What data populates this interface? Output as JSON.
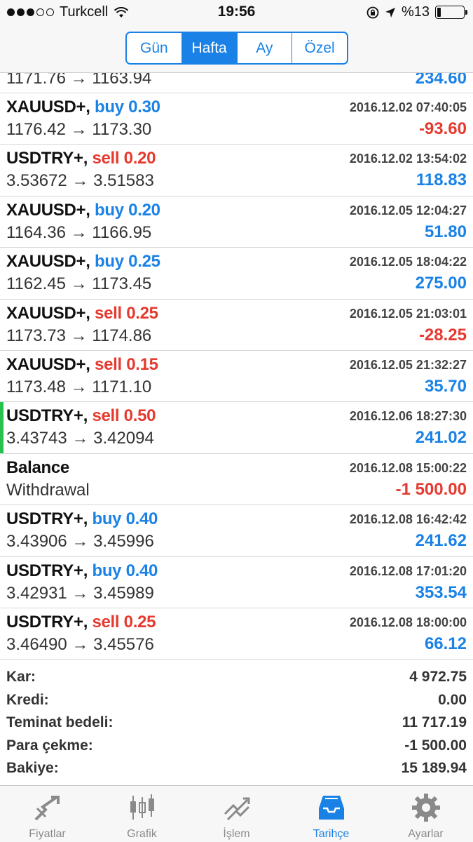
{
  "status_bar": {
    "carrier": "Turkcell",
    "time": "19:56",
    "battery": "%13",
    "battery_level": 0.13
  },
  "period_tabs": [
    {
      "label": "Gün",
      "active": false
    },
    {
      "label": "Hafta",
      "active": true
    },
    {
      "label": "Ay",
      "active": false
    },
    {
      "label": "Özel",
      "active": false
    }
  ],
  "partial_row": {
    "prices": "1171.76 → 1163.94",
    "profit": "234.60"
  },
  "deals": [
    {
      "symbol": "XAUUSD+,",
      "direction": "buy 0.30",
      "side": "buy",
      "date": "2016.12.02 07:40:05",
      "prices": "1176.42 → 1173.30",
      "profit": "-93.60",
      "sign": "neg"
    },
    {
      "symbol": "USDTRY+,",
      "direction": "sell 0.20",
      "side": "sell",
      "date": "2016.12.02 13:54:02",
      "prices": "3.53672 → 3.51583",
      "profit": "118.83",
      "sign": "pos"
    },
    {
      "symbol": "XAUUSD+,",
      "direction": "buy 0.20",
      "side": "buy",
      "date": "2016.12.05 12:04:27",
      "prices": "1164.36 → 1166.95",
      "profit": "51.80",
      "sign": "pos"
    },
    {
      "symbol": "XAUUSD+,",
      "direction": "buy 0.25",
      "side": "buy",
      "date": "2016.12.05 18:04:22",
      "prices": "1162.45 → 1173.45",
      "profit": "275.00",
      "sign": "pos"
    },
    {
      "symbol": "XAUUSD+,",
      "direction": "sell 0.25",
      "side": "sell",
      "date": "2016.12.05 21:03:01",
      "prices": "1173.73 → 1174.86",
      "profit": "-28.25",
      "sign": "neg"
    },
    {
      "symbol": "XAUUSD+,",
      "direction": "sell 0.15",
      "side": "sell",
      "date": "2016.12.05 21:32:27",
      "prices": "1173.48 → 1171.10",
      "profit": "35.70",
      "sign": "pos"
    },
    {
      "symbol": "USDTRY+,",
      "direction": "sell 0.50",
      "side": "sell",
      "date": "2016.12.06 18:27:30",
      "prices": "3.43743 → 3.42094",
      "profit": "241.02",
      "sign": "pos",
      "highlight": true
    },
    {
      "symbol": "Balance",
      "direction": "",
      "side": "none",
      "date": "2016.12.08 15:00:22",
      "prices": "Withdrawal",
      "profit": "-1 500.00",
      "sign": "neg"
    },
    {
      "symbol": "USDTRY+,",
      "direction": "buy 0.40",
      "side": "buy",
      "date": "2016.12.08 16:42:42",
      "prices": "3.43906 → 3.45996",
      "profit": "241.62",
      "sign": "pos"
    },
    {
      "symbol": "USDTRY+,",
      "direction": "buy 0.40",
      "side": "buy",
      "date": "2016.12.08 17:01:20",
      "prices": "3.42931 → 3.45989",
      "profit": "353.54",
      "sign": "pos"
    },
    {
      "symbol": "USDTRY+,",
      "direction": "sell 0.25",
      "side": "sell",
      "date": "2016.12.08 18:00:00",
      "prices": "3.46490 → 3.45576",
      "profit": "66.12",
      "sign": "pos"
    }
  ],
  "summary": [
    {
      "label": "Kar:",
      "value": "4 972.75"
    },
    {
      "label": "Kredi:",
      "value": "0.00"
    },
    {
      "label": "Teminat bedeli:",
      "value": "11 717.19"
    },
    {
      "label": "Para çekme:",
      "value": "-1 500.00"
    },
    {
      "label": "Bakiye:",
      "value": "15 189.94"
    }
  ],
  "tabs": [
    {
      "label": "Fiyatlar",
      "icon": "quotes-icon",
      "active": false
    },
    {
      "label": "Grafik",
      "icon": "chart-icon",
      "active": false
    },
    {
      "label": "İşlem",
      "icon": "trade-icon",
      "active": false
    },
    {
      "label": "Tarihçe",
      "icon": "history-icon",
      "active": true
    },
    {
      "label": "Ayarlar",
      "icon": "settings-icon",
      "active": false
    }
  ],
  "colors": {
    "accent": "#1a82e6",
    "loss": "#e53a2f",
    "highlight_bar": "#27c24c",
    "tab_inactive": "#8a8a8a"
  }
}
